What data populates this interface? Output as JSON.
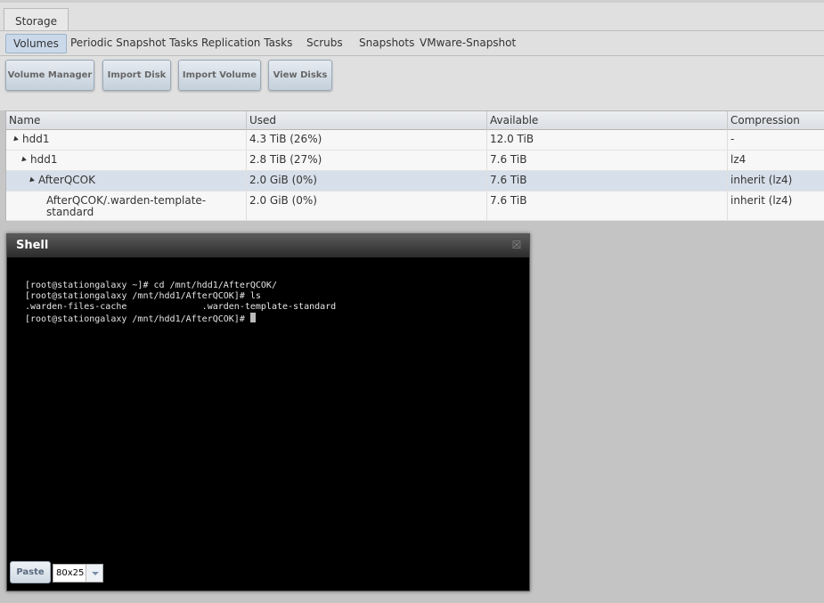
{
  "top_tabs": [
    {
      "label": "Storage"
    }
  ],
  "sub_tabs": [
    {
      "label": "Volumes"
    },
    {
      "label": "Periodic Snapshot Tasks"
    },
    {
      "label": "Replication Tasks"
    },
    {
      "label": "Scrubs"
    },
    {
      "label": "Snapshots"
    },
    {
      "label": "VMware-Snapshot"
    }
  ],
  "toolbar": {
    "volume_manager": "Volume Manager",
    "import_disk": "Import Disk",
    "import_volume": "Import Volume",
    "view_disks": "View Disks"
  },
  "grid": {
    "columns": [
      "Name",
      "Used",
      "Available",
      "Compression"
    ],
    "rows": [
      {
        "name": "hdd1",
        "used": "4.3 TiB (26%)",
        "available": "12.0 TiB",
        "compression": "-"
      },
      {
        "name": "hdd1",
        "used": "2.8 TiB (27%)",
        "available": "7.6 TiB",
        "compression": "lz4"
      },
      {
        "name": "AfterQCOK",
        "used": "2.0 GiB (0%)",
        "available": "7.6 TiB",
        "compression": "inherit (lz4)"
      },
      {
        "name": "AfterQCOK/.warden-template-standard",
        "used": "2.0 GiB (0%)",
        "available": "7.6 TiB",
        "compression": "inherit (lz4)"
      }
    ]
  },
  "shell": {
    "title": "Shell",
    "lines": [
      "[root@stationgalaxy ~]# cd /mnt/hdd1/AfterQCOK/",
      "[root@stationgalaxy /mnt/hdd1/AfterQCOK]# ls",
      ".warden-files-cache              .warden-template-standard",
      "[root@stationgalaxy /mnt/hdd1/AfterQCOK]# "
    ],
    "paste_label": "Paste",
    "size_value": "80x25"
  }
}
